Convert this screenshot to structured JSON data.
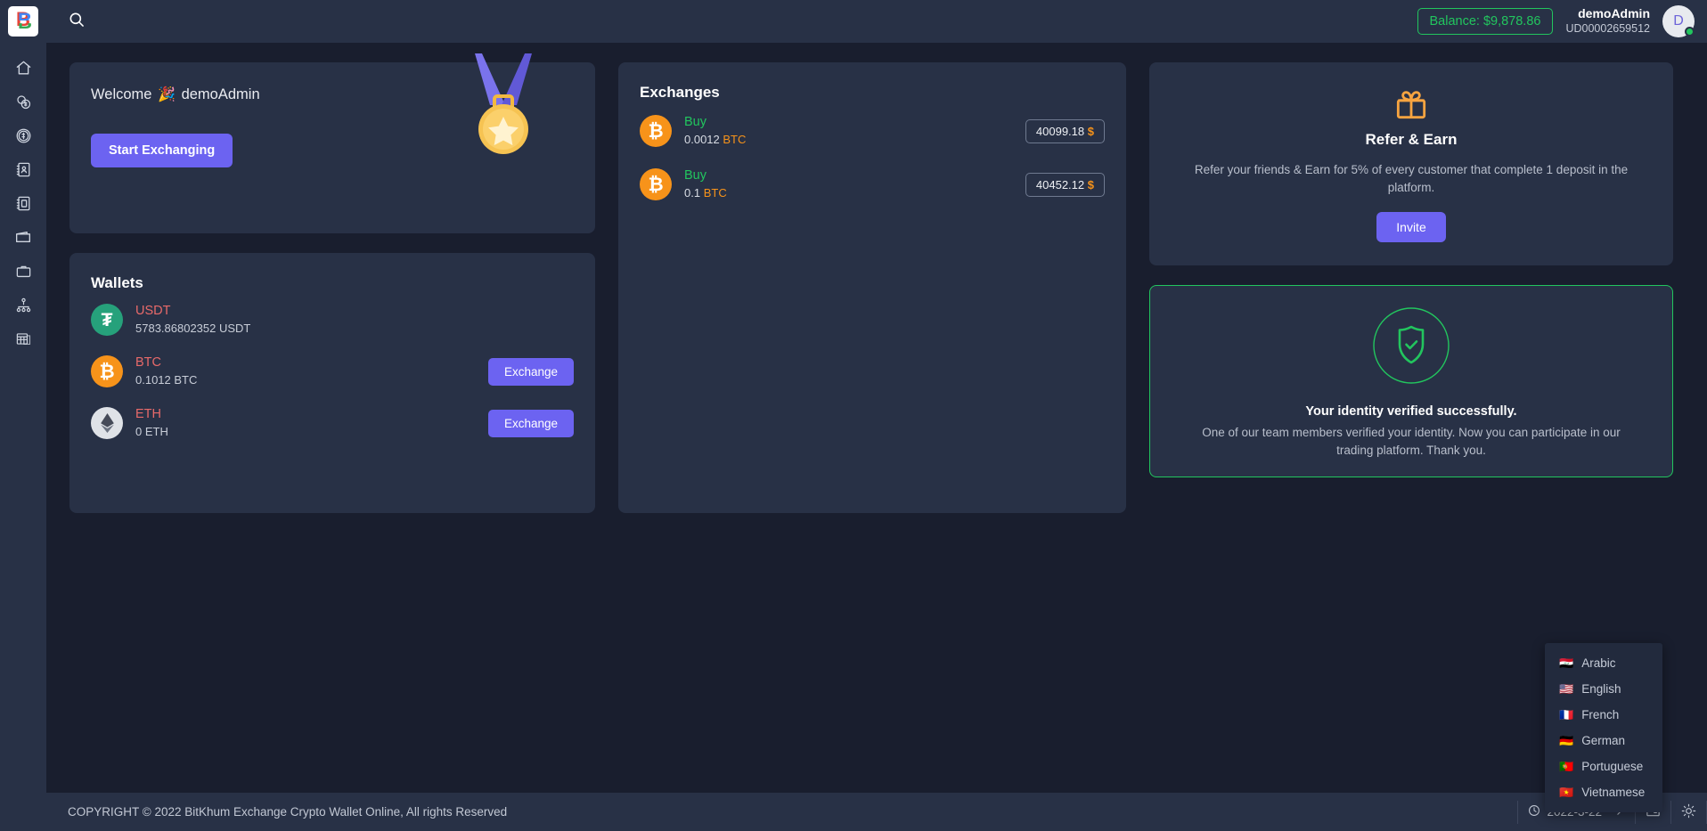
{
  "brand": {
    "logo_letter": "B"
  },
  "header": {
    "search_icon": "search-icon",
    "balance_label": "Balance: $9,878.86",
    "user_name": "demoAdmin",
    "user_id": "UD00002659512",
    "avatar_letter": "D"
  },
  "sidebar": {
    "items": [
      {
        "icon": "home-icon",
        "label": "Home"
      },
      {
        "icon": "coins-icon",
        "label": "Coins"
      },
      {
        "icon": "dollar-circle-icon",
        "label": "Currencies"
      },
      {
        "icon": "contact-card-icon",
        "label": "Accounts"
      },
      {
        "icon": "address-book-icon",
        "label": "Records"
      },
      {
        "icon": "wallet-icon",
        "label": "Wallet"
      },
      {
        "icon": "briefcase-icon",
        "label": "Portfolio"
      },
      {
        "icon": "sitemap-icon",
        "label": "Network"
      },
      {
        "icon": "spreadsheet-icon",
        "label": "Reports"
      }
    ]
  },
  "welcome": {
    "greeting": "Welcome",
    "emoji": "🎉",
    "user": "demoAdmin",
    "cta_label": "Start Exchanging",
    "medal_icon": "medal-icon"
  },
  "wallets": {
    "title": "Wallets",
    "rows": [
      {
        "symbol": "USDT",
        "amount": "5783.86802352 USDT",
        "icon": "tether-icon",
        "glyph": "₮",
        "action": null
      },
      {
        "symbol": "BTC",
        "amount": "0.1012 BTC",
        "icon": "bitcoin-icon",
        "glyph": "₿",
        "action": "Exchange"
      },
      {
        "symbol": "ETH",
        "amount": "0 ETH",
        "icon": "ethereum-icon",
        "glyph": "◆",
        "action": "Exchange"
      }
    ]
  },
  "exchanges": {
    "title": "Exchanges",
    "rows": [
      {
        "side": "Buy",
        "amount": "0.0012",
        "ticker": "BTC",
        "price": "40099.18",
        "currency": "$",
        "icon": "bitcoin-icon",
        "glyph": "₿"
      },
      {
        "side": "Buy",
        "amount": "0.1",
        "ticker": "BTC",
        "price": "40452.12",
        "currency": "$",
        "icon": "bitcoin-icon",
        "glyph": "₿"
      }
    ]
  },
  "refer": {
    "icon": "gift-icon",
    "title": "Refer & Earn",
    "description": "Refer your friends & Earn for 5% of every customer that complete 1 deposit in the platform.",
    "button_label": "Invite"
  },
  "verified": {
    "icon": "shield-check-icon",
    "title": "Your identity verified successfully.",
    "description": "One of our team members verified your identity. Now you can participate in our trading platform. Thank you."
  },
  "footer": {
    "copyright": "COPYRIGHT © 2022 BitKhum Exchange Crypto Wallet Online, All rights Reserved",
    "date": "2022-3-22",
    "clock_icon": "clock-icon",
    "chevron_icon": "chevron-right-icon",
    "fullscreen_icon": "fullscreen-icon",
    "theme_icon": "sun-icon"
  },
  "language_menu": {
    "items": [
      {
        "flag": "🇮🇶",
        "label": "Arabic"
      },
      {
        "flag": "🇺🇸",
        "label": "English"
      },
      {
        "flag": "🇫🇷",
        "label": "French"
      },
      {
        "flag": "🇩🇪",
        "label": "German"
      },
      {
        "flag": "🇵🇹",
        "label": "Portuguese"
      },
      {
        "flag": "🇻🇳",
        "label": "Vietnamese"
      }
    ]
  },
  "colors": {
    "accent": "#6c63f1",
    "success": "#22c55e",
    "bitcoin": "#f7931a",
    "tether": "#26a17b",
    "card_bg": "#283146",
    "page_bg": "#191e2e",
    "symbol_red": "#e86a6a"
  }
}
